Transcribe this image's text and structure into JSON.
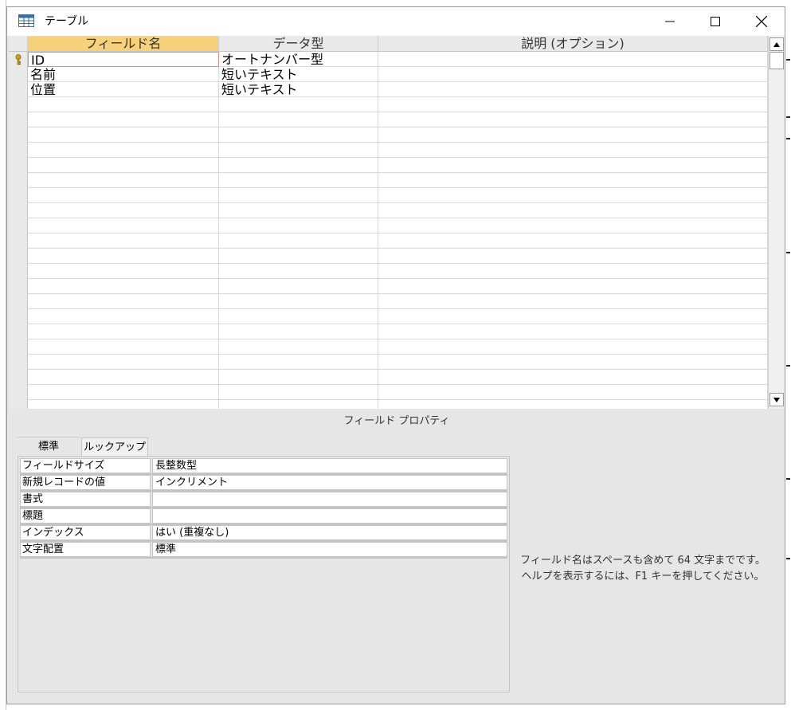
{
  "window": {
    "title": "テーブル",
    "icon": "table-icon",
    "controls": [
      "minimize-icon",
      "maximize-icon",
      "close-icon"
    ]
  },
  "grid": {
    "columns": [
      "フィールド名",
      "データ型",
      "説明 (オプション)"
    ],
    "rows": [
      {
        "field": "ID",
        "type": "オートナンバー型",
        "description": "",
        "primary_key": true
      },
      {
        "field": "名前",
        "type": "短いテキスト",
        "description": ""
      },
      {
        "field": "位置",
        "type": "短いテキスト",
        "description": ""
      }
    ]
  },
  "properties": {
    "section_title": "フィールド プロパティ",
    "tabs": [
      "標準",
      "ルックアップ"
    ],
    "active_tab": "標準",
    "rows": [
      {
        "label": "フィールドサイズ",
        "value": "長整数型"
      },
      {
        "label": "新規レコードの値",
        "value": "インクリメント"
      },
      {
        "label": "書式",
        "value": ""
      },
      {
        "label": "標題",
        "value": ""
      },
      {
        "label": "インデックス",
        "value": "はい (重複なし)"
      },
      {
        "label": "文字配置",
        "value": "標準"
      }
    ],
    "help_text": "フィールド名はスペースも含めて 64 文字までです。ヘルプを表示するには、F1 キーを押してください。"
  },
  "colors": {
    "active_header": "#f7d27a",
    "panel_bg": "#e6e6e6",
    "edit_border": "#e88a8a"
  }
}
